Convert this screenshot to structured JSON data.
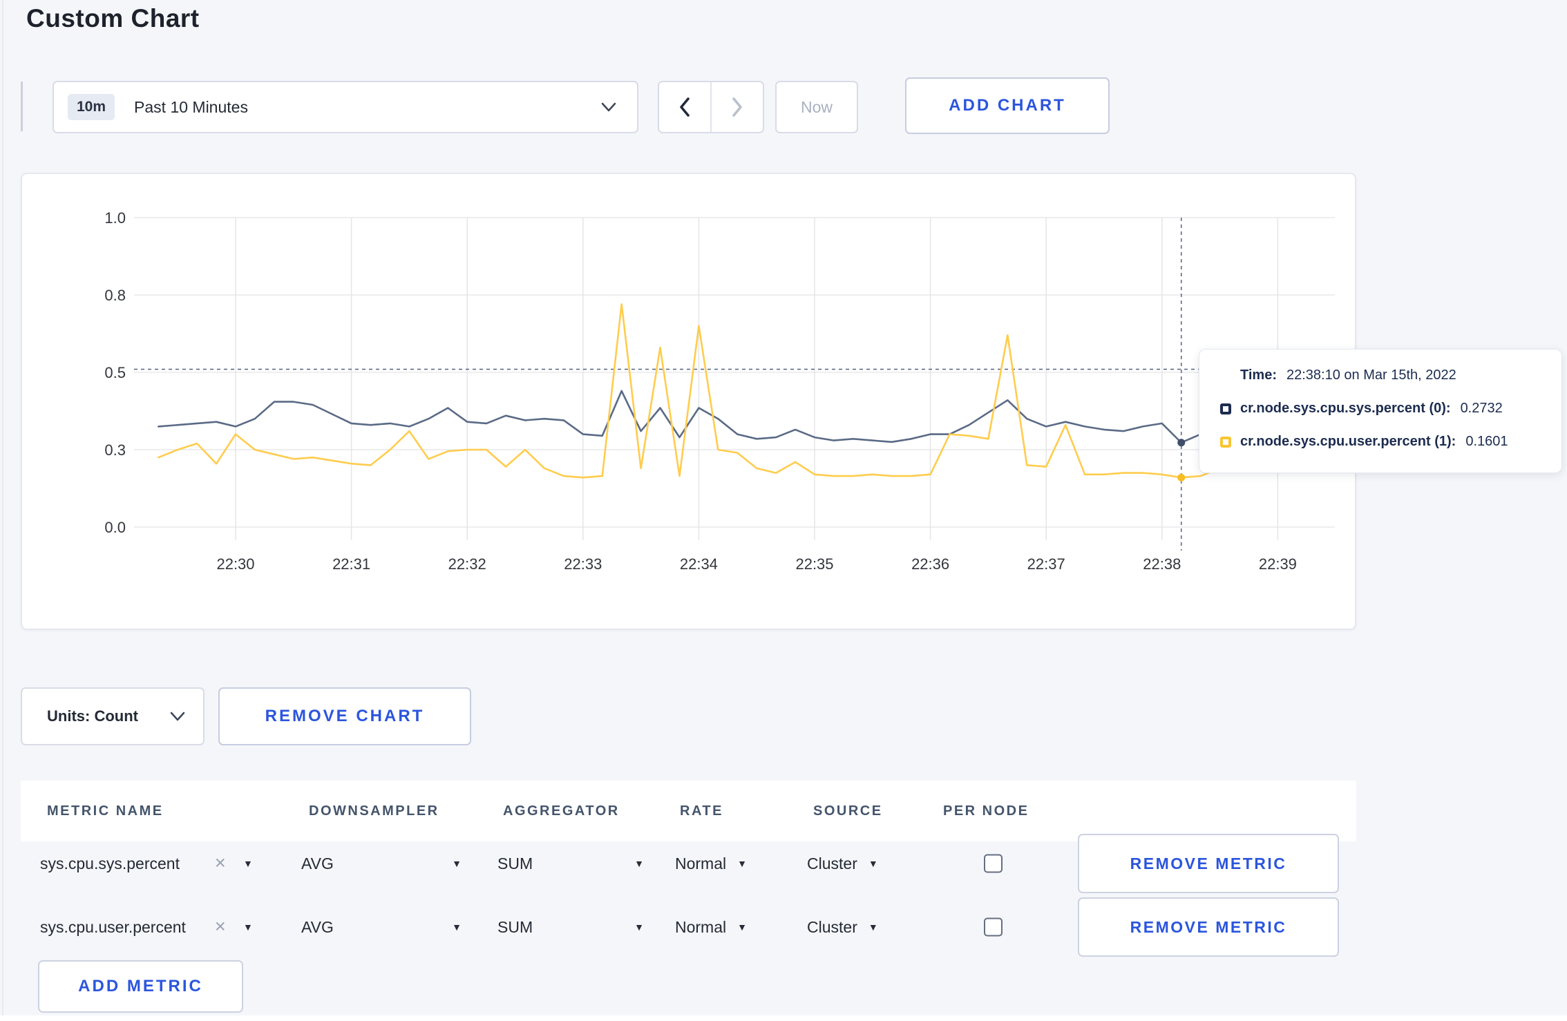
{
  "page": {
    "title": "Custom Chart"
  },
  "icons": {
    "close": "✕",
    "caret_down": "▼"
  },
  "colors": {
    "accent_blue": "#2b55dd",
    "sys_line": "#5a6a86",
    "user_line": "#ffcc4d",
    "sys_marker": "#3f4f6b",
    "user_marker": "#f7bd27",
    "crosshair": "#5d6c87",
    "tooltip_text": "#1c2c4f"
  },
  "toolbar": {
    "range_badge": "10m",
    "range_label": "Past 10 Minutes",
    "prev_label": "‹",
    "next_label": "›",
    "now_label": "Now",
    "add_chart_label": "ADD CHART"
  },
  "chart_data": {
    "type": "line",
    "title": "",
    "xlabel": "",
    "ylabel": "",
    "ylim": [
      0,
      1
    ],
    "grid": true,
    "y_tick_values": [
      0,
      0.25,
      0.5,
      0.75,
      1.0
    ],
    "y_tick_labels": [
      "0.0",
      "0.3",
      "0.5",
      "0.8",
      "1.0"
    ],
    "x_tick_labels": [
      "22:30",
      "22:31",
      "22:32",
      "22:33",
      "22:34",
      "22:35",
      "22:36",
      "22:37",
      "22:38",
      "22:39"
    ],
    "x_start": "22:29:20",
    "x_step_seconds": 10,
    "series": [
      {
        "name": "cr.node.sys.cpu.sys.percent (0)",
        "color": "#5a6a86",
        "dot_color": "#3f4f6b",
        "values": [
          0.325,
          0.33,
          0.335,
          0.34,
          0.325,
          0.35,
          0.405,
          0.405,
          0.395,
          0.365,
          0.335,
          0.33,
          0.335,
          0.325,
          0.35,
          0.385,
          0.34,
          0.335,
          0.36,
          0.345,
          0.35,
          0.345,
          0.3,
          0.295,
          0.44,
          0.31,
          0.385,
          0.29,
          0.385,
          0.35,
          0.3,
          0.285,
          0.29,
          0.315,
          0.29,
          0.28,
          0.285,
          0.28,
          0.275,
          0.285,
          0.3,
          0.3,
          0.33,
          0.37,
          0.41,
          0.35,
          0.325,
          0.34,
          0.325,
          0.315,
          0.31,
          0.325,
          0.335,
          0.273,
          0.3,
          0.31,
          0.3,
          0.315,
          0.305,
          0.295,
          0.31
        ]
      },
      {
        "name": "cr.node.sys.cpu.user.percent (1)",
        "color": "#ffcc4d",
        "dot_color": "#f7bd27",
        "values": [
          0.225,
          0.25,
          0.27,
          0.205,
          0.3,
          0.25,
          0.235,
          0.22,
          0.225,
          0.215,
          0.205,
          0.2,
          0.25,
          0.31,
          0.22,
          0.245,
          0.25,
          0.25,
          0.195,
          0.25,
          0.19,
          0.165,
          0.16,
          0.165,
          0.72,
          0.19,
          0.58,
          0.165,
          0.65,
          0.25,
          0.24,
          0.19,
          0.175,
          0.21,
          0.17,
          0.165,
          0.165,
          0.17,
          0.165,
          0.165,
          0.17,
          0.3,
          0.295,
          0.285,
          0.62,
          0.2,
          0.195,
          0.33,
          0.17,
          0.17,
          0.175,
          0.175,
          0.17,
          0.16,
          0.165,
          0.19,
          0.27,
          0.28,
          0.28,
          0.215,
          0.27
        ]
      }
    ],
    "crosshair": {
      "time": "22:38:10",
      "index": 53,
      "y_value": 0.51
    },
    "legend_position": "tooltip"
  },
  "tooltip": {
    "time_label": "Time:",
    "time_value": "22:38:10 on Mar 15th, 2022",
    "rows": [
      {
        "label": "cr.node.sys.cpu.sys.percent (0):",
        "value": "0.2732",
        "color": "#1c2c4f"
      },
      {
        "label": "cr.node.sys.cpu.user.percent (1):",
        "value": "0.1601",
        "color": "#f9c533"
      }
    ]
  },
  "chart_controls": {
    "units_label": "Units: Count",
    "remove_chart_label": "REMOVE CHART"
  },
  "metrics_table": {
    "headers": [
      "METRIC NAME",
      "DOWNSAMPLER",
      "AGGREGATOR",
      "RATE",
      "SOURCE",
      "PER NODE"
    ],
    "rows": [
      {
        "metric": "sys.cpu.sys.percent",
        "downsampler": "AVG",
        "aggregator": "SUM",
        "rate": "Normal",
        "source": "Cluster",
        "per_node_checked": false,
        "remove_label": "REMOVE METRIC"
      },
      {
        "metric": "sys.cpu.user.percent",
        "downsampler": "AVG",
        "aggregator": "SUM",
        "rate": "Normal",
        "source": "Cluster",
        "per_node_checked": false,
        "remove_label": "REMOVE METRIC"
      }
    ],
    "add_metric_label": "ADD METRIC"
  }
}
